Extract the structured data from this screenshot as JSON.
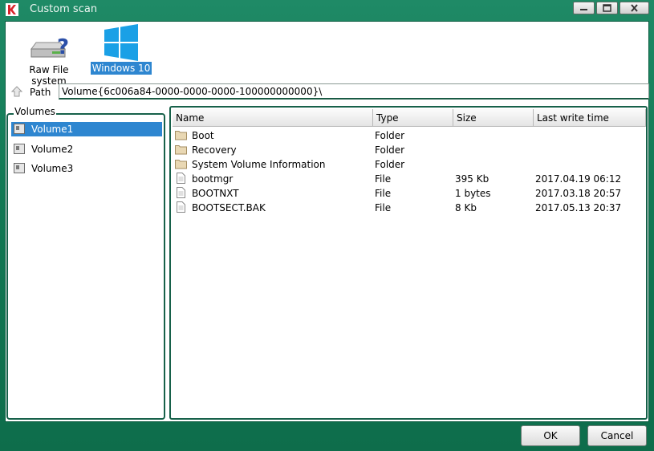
{
  "window": {
    "title": "Custom scan"
  },
  "drives": [
    {
      "label": "Raw File system",
      "icon": "hard-drive-question-icon",
      "selected": false
    },
    {
      "label": "Windows 10",
      "icon": "windows-logo-icon",
      "selected": true
    }
  ],
  "path": {
    "label": "Path",
    "value": "Volume{6c006a84-0000-0000-0000-100000000000}\\"
  },
  "volumes": {
    "legend": "Volumes",
    "items": [
      {
        "label": "Volume1",
        "selected": true
      },
      {
        "label": "Volume2",
        "selected": false
      },
      {
        "label": "Volume3",
        "selected": false
      }
    ]
  },
  "files": {
    "columns": [
      "Name",
      "Type",
      "Size",
      "Last write time"
    ],
    "rows": [
      {
        "name": "Boot",
        "type": "Folder",
        "size": "",
        "time": "",
        "icon": "folder-icon"
      },
      {
        "name": "Recovery",
        "type": "Folder",
        "size": "",
        "time": "",
        "icon": "folder-icon"
      },
      {
        "name": "System Volume Information",
        "type": "Folder",
        "size": "",
        "time": "",
        "icon": "folder-icon"
      },
      {
        "name": "bootmgr",
        "type": "File",
        "size": "395 Kb",
        "time": "2017.04.19 06:12",
        "icon": "file-icon"
      },
      {
        "name": "BOOTNXT",
        "type": "File",
        "size": "1 bytes",
        "time": "2017.03.18 20:57",
        "icon": "file-icon"
      },
      {
        "name": "BOOTSECT.BAK",
        "type": "File",
        "size": "8 Kb",
        "time": "2017.05.13 20:37",
        "icon": "file-icon"
      }
    ]
  },
  "buttons": {
    "ok": "OK",
    "cancel": "Cancel"
  },
  "colors": {
    "titlebar": "#1f8a66",
    "selection": "#2e86d0",
    "frame": "#17614a"
  }
}
